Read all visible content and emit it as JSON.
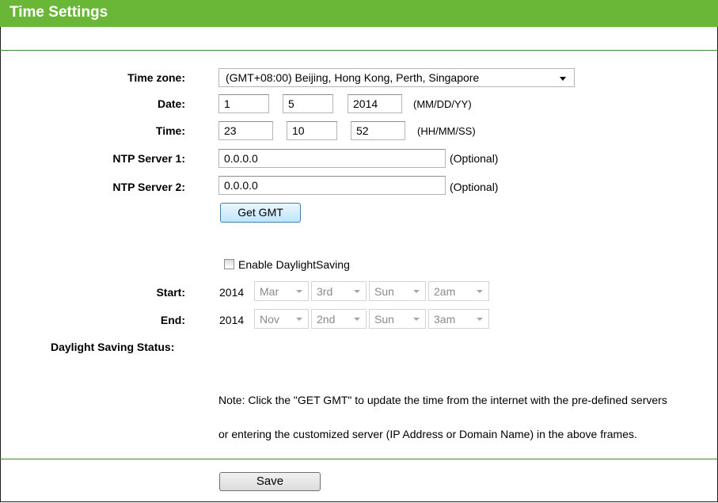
{
  "page": {
    "title": "Time Settings"
  },
  "form": {
    "timezone": {
      "label": "Time zone:",
      "value": "(GMT+08:00) Beijing, Hong Kong, Perth, Singapore"
    },
    "date": {
      "label": "Date:",
      "month": "1",
      "day": "5",
      "year": "2014",
      "format": "(MM/DD/YY)"
    },
    "time": {
      "label": "Time:",
      "hour": "23",
      "minute": "10",
      "second": "52",
      "format": "(HH/MM/SS)"
    },
    "ntp1": {
      "label": "NTP Server 1:",
      "value": "0.0.0.0",
      "hint": "(Optional)"
    },
    "ntp2": {
      "label": "NTP Server 2:",
      "value": "0.0.0.0",
      "hint": "(Optional)"
    },
    "get_gmt_label": "Get GMT",
    "dst": {
      "checkbox_label": "Enable DaylightSaving",
      "checked": false,
      "start": {
        "label": "Start:",
        "year": "2014",
        "month": "Mar",
        "week": "3rd",
        "day": "Sun",
        "hour": "2am"
      },
      "end": {
        "label": "End:",
        "year": "2014",
        "month": "Nov",
        "week": "2nd",
        "day": "Sun",
        "hour": "3am"
      },
      "status_label": "Daylight Saving Status:"
    },
    "note_line1": "Note: Click the \"GET GMT\" to update the time from the internet with the pre-defined servers",
    "note_line2": "or entering the customized server (IP Address or Domain Name) in the above frames.",
    "save_label": "Save"
  },
  "colors": {
    "header_green": "#6ab738",
    "divider_green": "#3a8a3a"
  }
}
